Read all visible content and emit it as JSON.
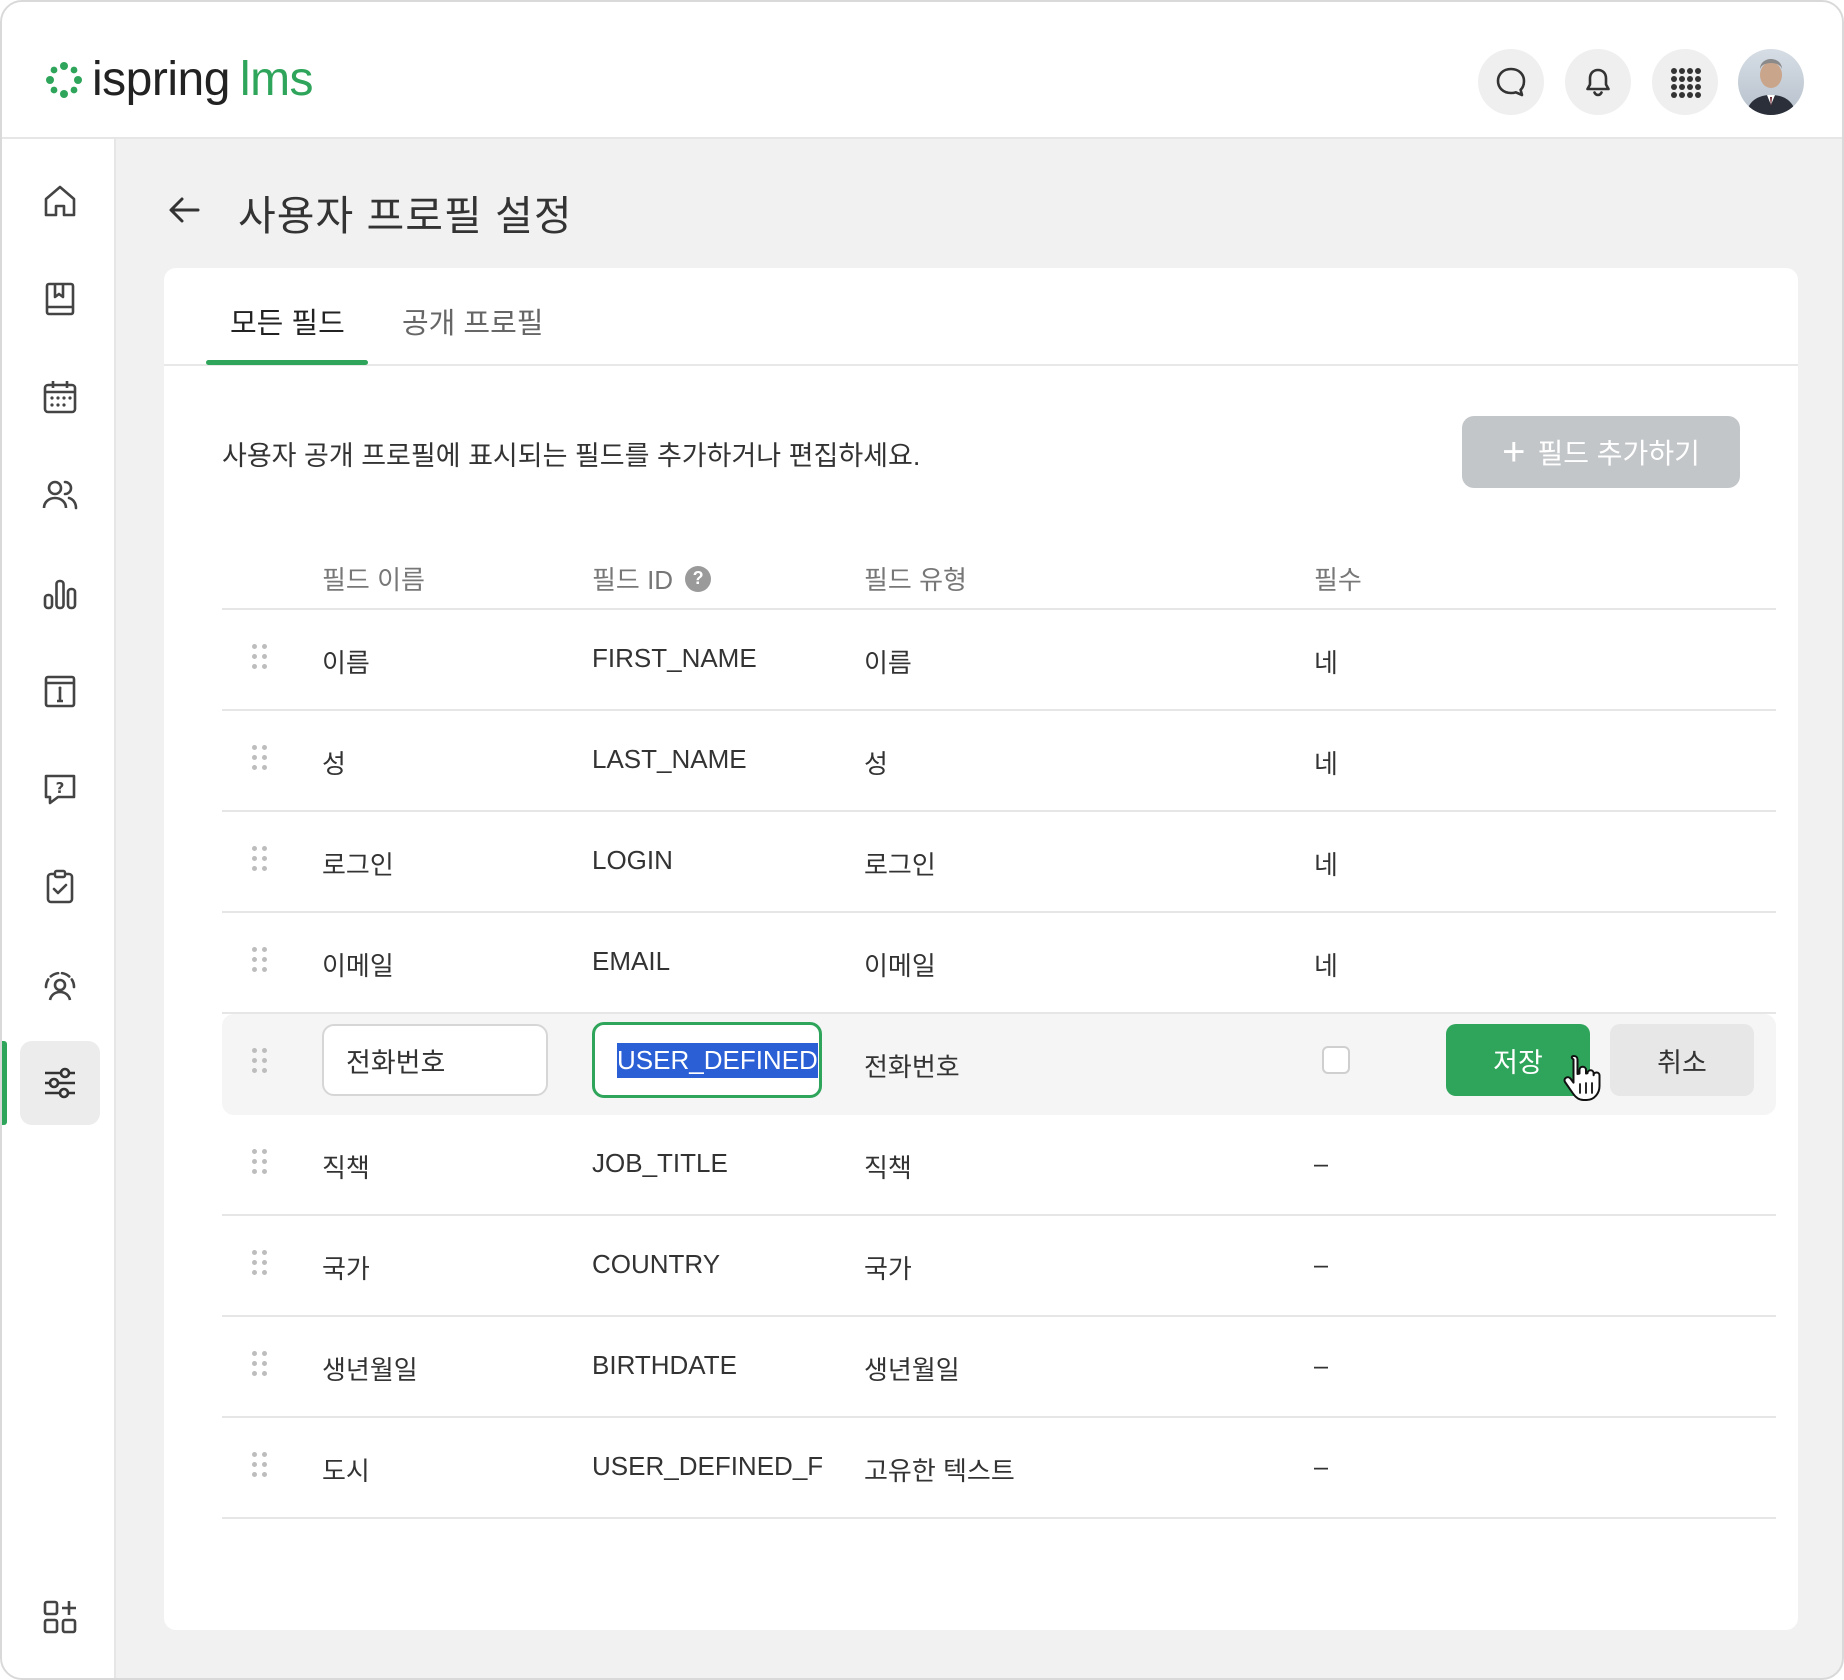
{
  "app": {
    "logo_text": "ispring",
    "logo_accent": "lms",
    "brand_color": "#2ea55a"
  },
  "header": {
    "icons": [
      "chat-icon",
      "bell-icon",
      "apps-grid-icon"
    ],
    "avatar": "user-avatar"
  },
  "sidebar": {
    "items": [
      {
        "icon": "home-icon"
      },
      {
        "icon": "courses-icon"
      },
      {
        "icon": "calendar-icon"
      },
      {
        "icon": "users-icon"
      },
      {
        "icon": "reports-icon"
      },
      {
        "icon": "info-icon"
      },
      {
        "icon": "help-icon"
      },
      {
        "icon": "tasks-icon"
      },
      {
        "icon": "coach-icon"
      },
      {
        "icon": "settings-icon",
        "active": true
      }
    ],
    "bottom_icon": "add-widget-icon"
  },
  "page": {
    "title": "사용자 프로필 설정"
  },
  "tabs": [
    {
      "label": "모든 필드",
      "active": true
    },
    {
      "label": "공개 프로필",
      "active": false
    }
  ],
  "description": "사용자 공개 프로필에 표시되는 필드를 추가하거나 편집하세요.",
  "add_button": {
    "plus": "+",
    "label": "필드 추가하기"
  },
  "table": {
    "columns": {
      "name": "필드 이름",
      "id": "필드 ID",
      "type": "필드 유형",
      "required": "필수"
    },
    "help_glyph": "?",
    "rows": [
      {
        "name": "이름",
        "id": "FIRST_NAME",
        "type": "이름",
        "required": "네"
      },
      {
        "name": "성",
        "id": "LAST_NAME",
        "type": "성",
        "required": "네"
      },
      {
        "name": "로그인",
        "id": "LOGIN",
        "type": "로그인",
        "required": "네"
      },
      {
        "name": "이메일",
        "id": "EMAIL",
        "type": "이메일",
        "required": "네"
      }
    ],
    "edit_row": {
      "name_value": "전화번호",
      "id_value": "USER_DEFINED",
      "type": "전화번호",
      "required_checked": false,
      "save_label": "저장",
      "cancel_label": "취소"
    },
    "rows_after": [
      {
        "name": "직책",
        "id": "JOB_TITLE",
        "type": "직책",
        "required": "–"
      },
      {
        "name": "국가",
        "id": "COUNTRY",
        "type": "국가",
        "required": "–"
      },
      {
        "name": "생년월일",
        "id": "BIRTHDATE",
        "type": "생년월일",
        "required": "–"
      },
      {
        "name": "도시",
        "id": "USER_DEFINED_FIEL",
        "type": "고유한 텍스트",
        "required": "–"
      }
    ]
  }
}
